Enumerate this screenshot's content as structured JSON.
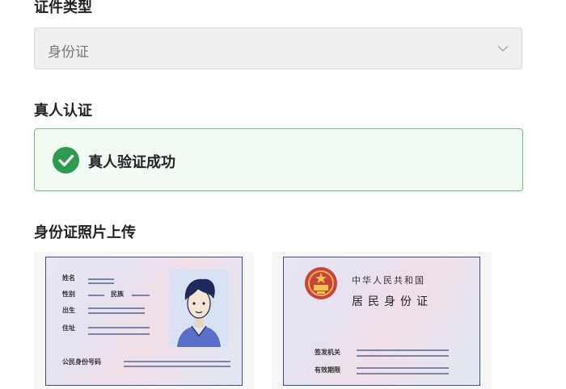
{
  "id_type": {
    "label": "证件类型",
    "selected": "身份证"
  },
  "verification": {
    "label": "真人认证",
    "status_text": "真人验证成功",
    "status_color": "#2e9a4f"
  },
  "upload": {
    "label": "身份证照片上传",
    "front": {
      "fields": {
        "name": "姓名",
        "gender": "性别",
        "ethnicity": "民族",
        "birth": "出生",
        "address": "住址",
        "id_number": "公民身份号码"
      }
    },
    "back": {
      "title_line1": "中华人民共和国",
      "title_line2": "居民身份证",
      "fields": {
        "issuer": "签发机关",
        "validity": "有效期限"
      }
    }
  }
}
